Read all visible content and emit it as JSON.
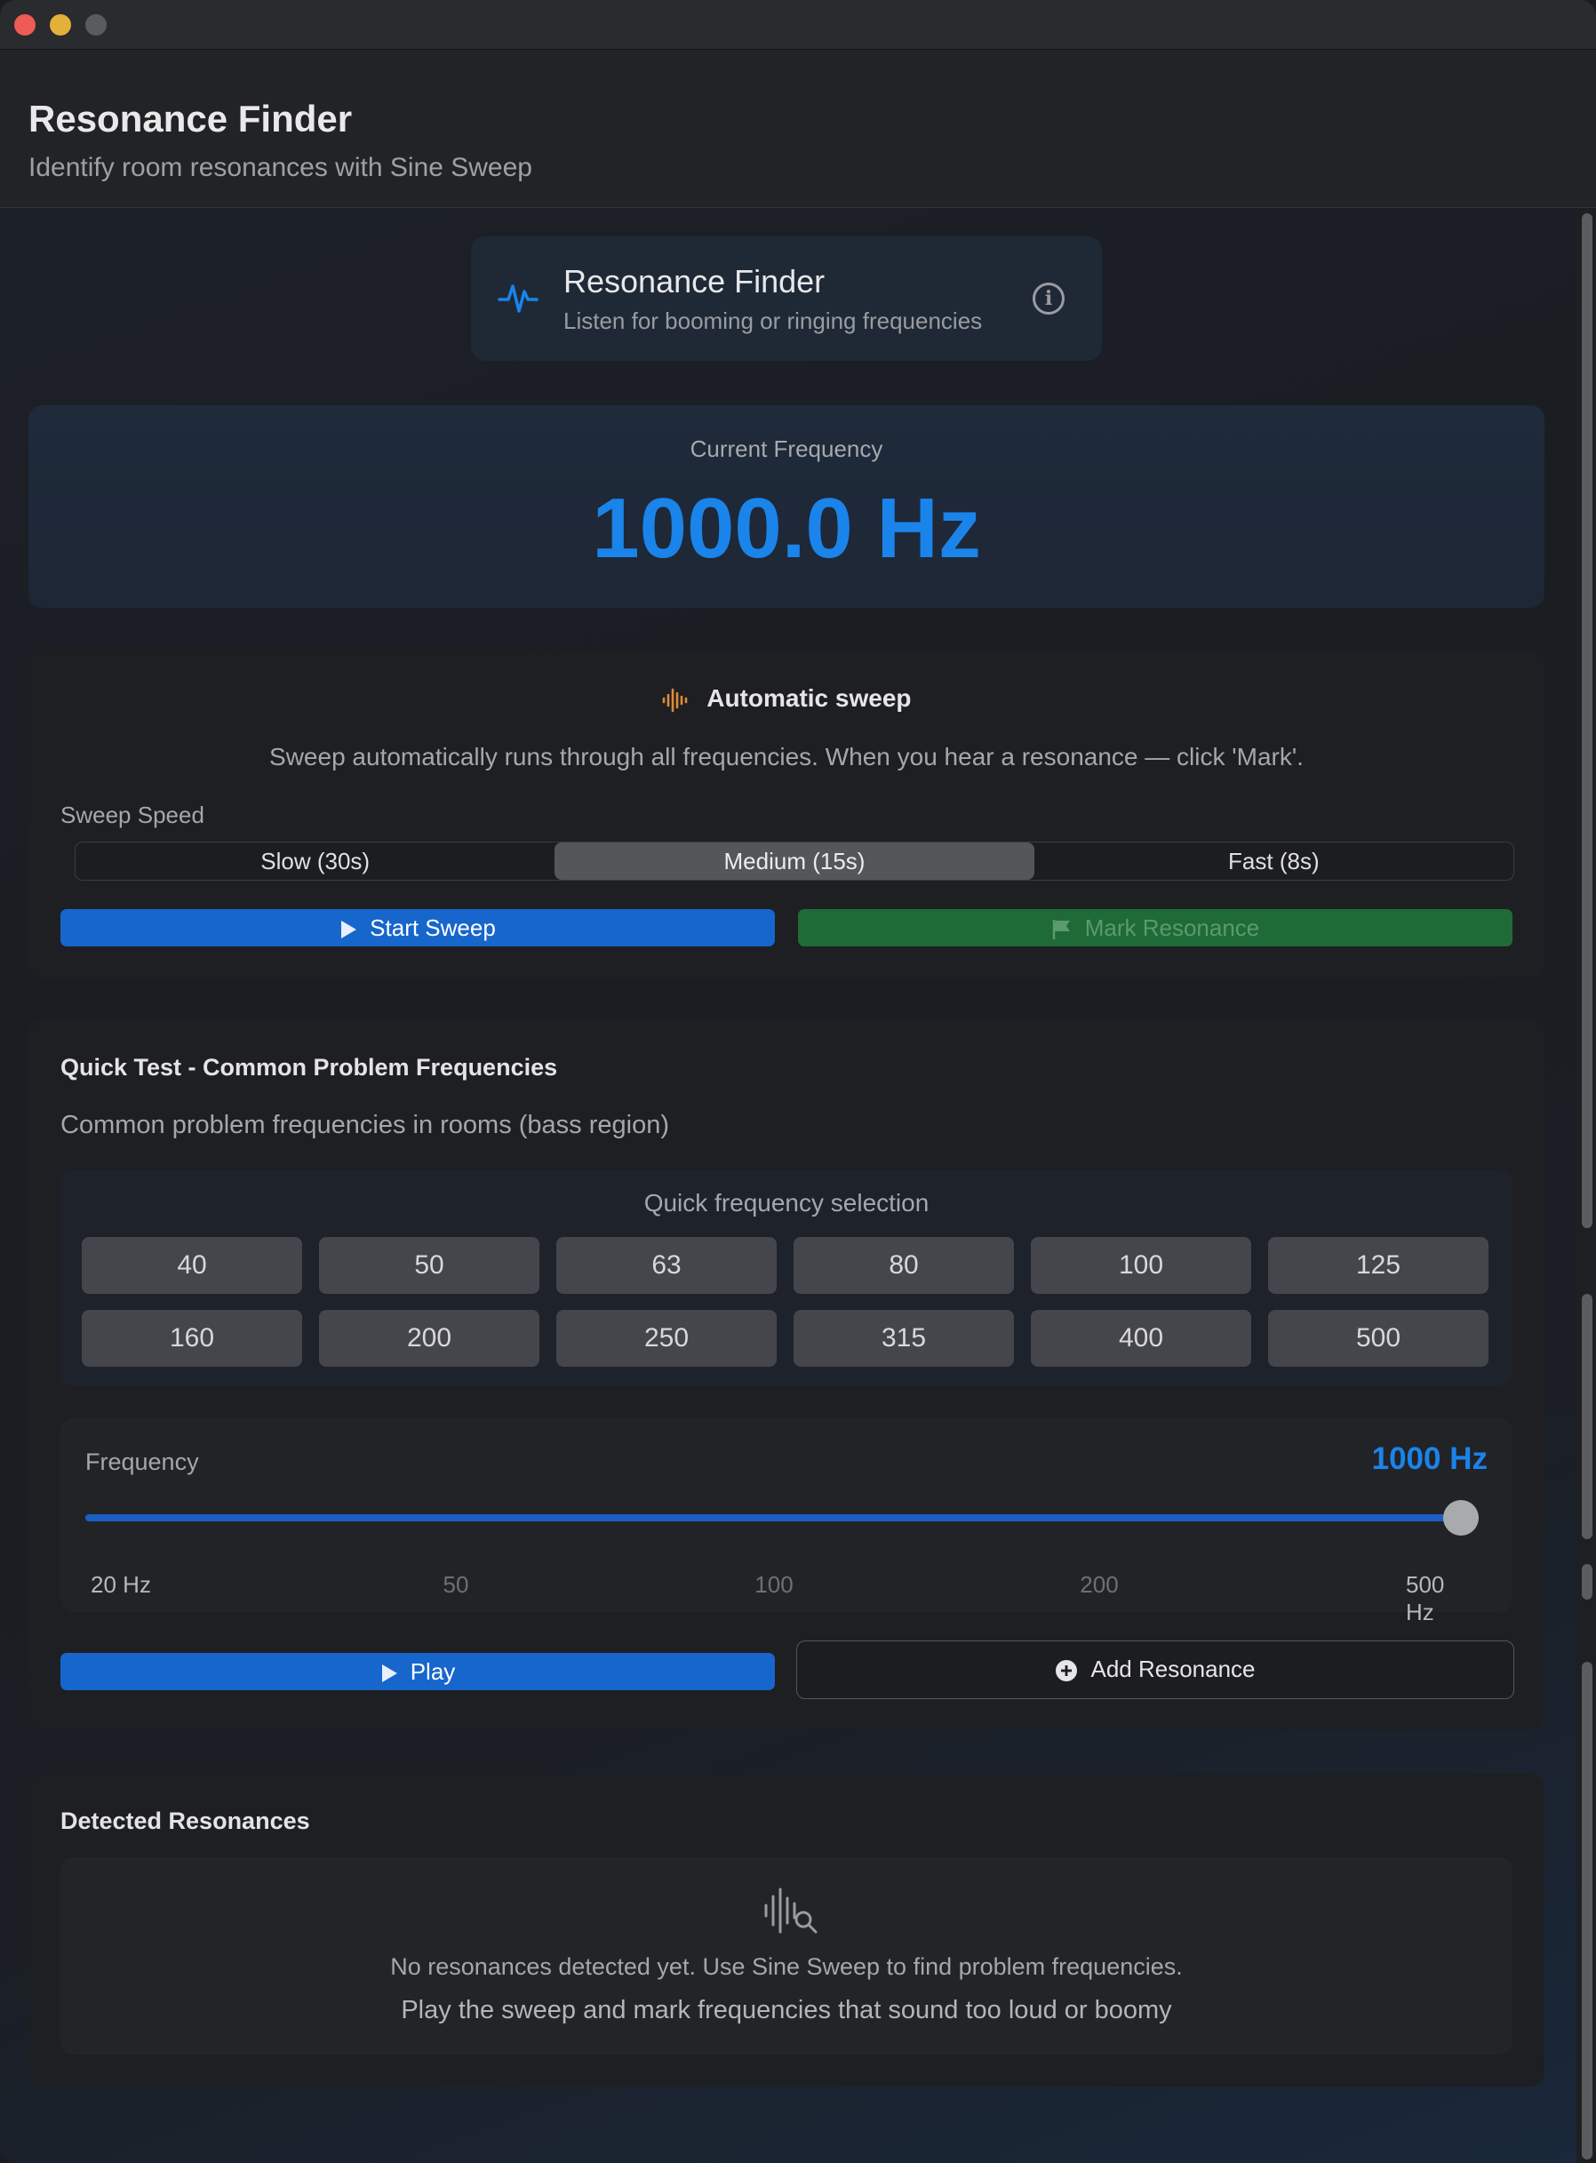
{
  "window": {
    "title": "Resonance Finder",
    "subtitle": "Identify room resonances with Sine Sweep"
  },
  "info_card": {
    "title": "Resonance Finder",
    "subtitle": "Listen for booming or ringing frequencies",
    "info_symbol": "i"
  },
  "current": {
    "label": "Current Frequency",
    "value": "1000.0 Hz"
  },
  "sweep": {
    "title": "Automatic sweep",
    "description": "Sweep automatically runs through all frequencies. When you hear a resonance — click 'Mark'.",
    "speed_label": "Sweep Speed",
    "speeds": [
      "Slow (30s)",
      "Medium (15s)",
      "Fast (8s)"
    ],
    "selected_speed": "Medium (15s)",
    "start_label": "Start Sweep",
    "mark_label": "Mark Resonance"
  },
  "quick_test": {
    "title": "Quick Test - Common Problem Frequencies",
    "description": "Common problem frequencies in rooms (bass region)",
    "grid_title": "Quick frequency selection",
    "frequencies": [
      "40",
      "50",
      "63",
      "80",
      "100",
      "125",
      "160",
      "200",
      "250",
      "315",
      "400",
      "500"
    ]
  },
  "slider": {
    "label": "Frequency",
    "value_label": "1000 Hz",
    "position": 1.0,
    "ticks": [
      "20 Hz",
      "50",
      "100",
      "200",
      "500 Hz"
    ]
  },
  "actions": {
    "play_label": "Play",
    "add_label": "Add Resonance"
  },
  "detected": {
    "title": "Detected Resonances",
    "empty_message": "No resonances detected yet. Use Sine Sweep to find problem frequencies.",
    "empty_hint": "Play the sweep and mark frequencies that sound too loud or boomy"
  },
  "colors": {
    "accent": "#1a84ea",
    "primary_button": "#1666cc",
    "mark_button": "#1f6b37",
    "sweep_icon": "#e08a3a"
  },
  "icons": {
    "info_card": "waveform-pulse-icon",
    "sweep": "waveform-icon",
    "start": "play-icon",
    "mark": "flag-icon",
    "add": "plus-circle-icon",
    "empty": "waveform-magnifier-icon"
  }
}
